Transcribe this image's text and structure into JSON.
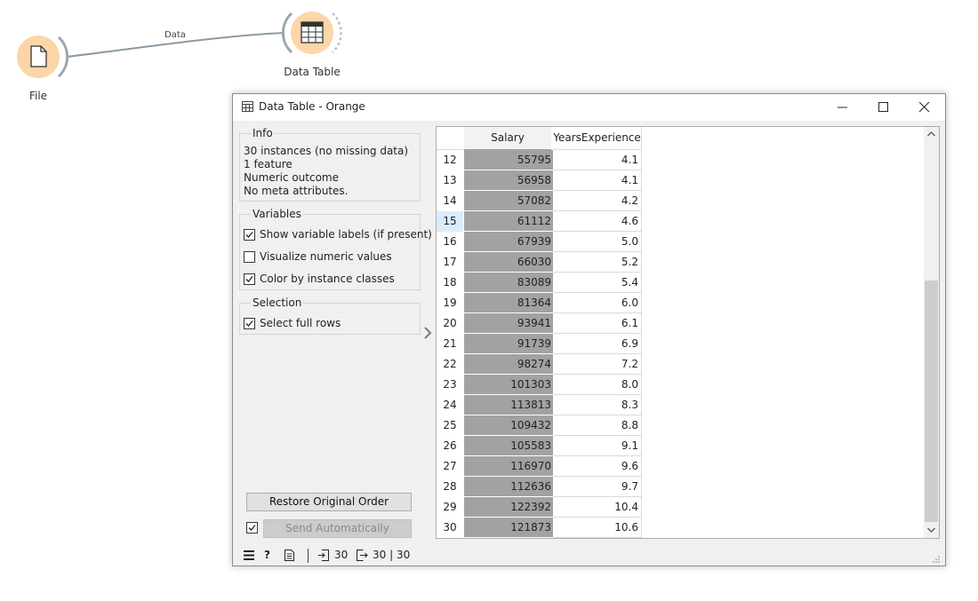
{
  "canvas": {
    "nodes": [
      {
        "label": "File",
        "icon": "document-icon"
      },
      {
        "label": "Data Table",
        "icon": "table-icon"
      }
    ],
    "link_label": "Data",
    "node_color": "#fcd5a8",
    "node_border": "#f5b97a",
    "link_color": "#8a9aa6"
  },
  "window": {
    "title": "Data Table - Orange",
    "controls": [
      "minimize-icon",
      "maximize-icon",
      "close-icon"
    ]
  },
  "info": {
    "title": "Info",
    "lines": [
      "30 instances (no missing data)",
      "1 feature",
      "Numeric outcome",
      "No meta attributes."
    ]
  },
  "variables": {
    "title": "Variables",
    "options": [
      {
        "label": "Show variable labels (if present)",
        "checked": true
      },
      {
        "label": "Visualize numeric values",
        "checked": false
      },
      {
        "label": "Color by instance classes",
        "checked": true
      }
    ]
  },
  "selection": {
    "title": "Selection",
    "options": [
      {
        "label": "Select full rows",
        "checked": true
      }
    ]
  },
  "buttons": {
    "restore": "Restore Original Order",
    "send": "Send Automatically",
    "send_auto_checked": true
  },
  "table": {
    "columns": [
      "Salary",
      "YearsExperience"
    ],
    "selected_row": "15",
    "rows": [
      {
        "n": "12",
        "salary": "55795",
        "years": "4.1"
      },
      {
        "n": "13",
        "salary": "56958",
        "years": "4.1"
      },
      {
        "n": "14",
        "salary": "57082",
        "years": "4.2"
      },
      {
        "n": "15",
        "salary": "61112",
        "years": "4.6"
      },
      {
        "n": "16",
        "salary": "67939",
        "years": "5.0"
      },
      {
        "n": "17",
        "salary": "66030",
        "years": "5.2"
      },
      {
        "n": "18",
        "salary": "83089",
        "years": "5.4"
      },
      {
        "n": "19",
        "salary": "81364",
        "years": "6.0"
      },
      {
        "n": "20",
        "salary": "93941",
        "years": "6.1"
      },
      {
        "n": "21",
        "salary": "91739",
        "years": "6.9"
      },
      {
        "n": "22",
        "salary": "98274",
        "years": "7.2"
      },
      {
        "n": "23",
        "salary": "101303",
        "years": "8.0"
      },
      {
        "n": "24",
        "salary": "113813",
        "years": "8.3"
      },
      {
        "n": "25",
        "salary": "109432",
        "years": "8.8"
      },
      {
        "n": "26",
        "salary": "105583",
        "years": "9.1"
      },
      {
        "n": "27",
        "salary": "116970",
        "years": "9.6"
      },
      {
        "n": "28",
        "salary": "112636",
        "years": "9.7"
      },
      {
        "n": "29",
        "salary": "122392",
        "years": "10.4"
      },
      {
        "n": "30",
        "salary": "121873",
        "years": "10.6"
      }
    ]
  },
  "status": {
    "input_count": "30",
    "output_count": "30 | 30"
  }
}
